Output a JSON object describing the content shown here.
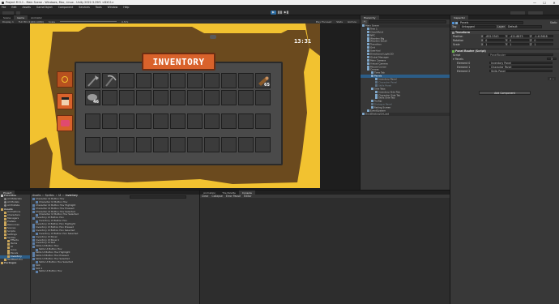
{
  "window": {
    "title": "Project M 0.1 - Main Scene - Windows, Mac, Linux - Unity 2022.3.25f1 <DX11>",
    "minimize": "—",
    "maximize": "☐",
    "close": "✕"
  },
  "menu": [
    "File",
    "Edit",
    "Assets",
    "GameObject",
    "Component",
    "Services",
    "Tools",
    "Window",
    "Help"
  ],
  "tabs": {
    "scene": "Scene",
    "game": "Game",
    "animator": "Animator"
  },
  "game_toolbar": {
    "display": "Game",
    "display_num": "Display 1",
    "aspect": "Full HD (1920x1080)",
    "scale": "Scale",
    "scale_value": "0.57x",
    "play_mode": "Play Focused",
    "stats": "Stats",
    "gizmos": "Gizmos"
  },
  "game": {
    "clock": "13:31",
    "inventory_title": "INVENTORY",
    "slot_counts": {
      "stone": "46",
      "log": "65"
    },
    "colors": {
      "sand": "#f2c230",
      "dirt": "#6b4a1e",
      "accent": "#d9622b"
    }
  },
  "hierarchy": {
    "tab": "Hierarchy",
    "search_placeholder": "All",
    "items": [
      {
        "label": "Main Scene",
        "indent": 0,
        "type": "scene"
      },
      {
        "label": "Tree 1",
        "indent": 1
      },
      {
        "label": "CheckPoint",
        "indent": 1
      },
      {
        "label": "NPC",
        "indent": 1
      },
      {
        "label": "Wooden Big",
        "indent": 1
      },
      {
        "label": "Wooden Small",
        "indent": 1
      },
      {
        "label": "Transition",
        "indent": 1
      },
      {
        "label": "Grid",
        "indent": 1
      },
      {
        "label": "UserHud",
        "indent": 1
      },
      {
        "label": "Directional Light 2D",
        "indent": 1
      },
      {
        "label": "Global Manager",
        "indent": 1
      },
      {
        "label": "Main Camera",
        "indent": 1
      },
      {
        "label": "Virtual Camera",
        "indent": 1
      },
      {
        "label": "Mouse Cursor",
        "indent": 1
      },
      {
        "label": "Canvas",
        "indent": 1
      },
      {
        "label": "Time Tab",
        "indent": 2
      },
      {
        "label": "Panels",
        "indent": 2,
        "selected": true
      },
      {
        "label": "Inventory Panel",
        "indent": 3
      },
      {
        "label": "Character Panel",
        "indent": 3,
        "dim": true
      },
      {
        "label": "Skills Panel",
        "indent": 3,
        "dim": true
      },
      {
        "label": "Side Tabs",
        "indent": 2
      },
      {
        "label": "Inventory Side Tab",
        "indent": 3
      },
      {
        "label": "Character Side Tab",
        "indent": 3
      },
      {
        "label": "Skills Side Tab",
        "indent": 3
      },
      {
        "label": "Tooltip",
        "indent": 2
      },
      {
        "label": "Dialogue Panel",
        "indent": 2,
        "dim": true
      },
      {
        "label": "Fading Screen",
        "indent": 2
      },
      {
        "label": "EventSystem",
        "indent": 1
      },
      {
        "label": "DontDestroyOnLoad",
        "indent": 0,
        "type": "scene"
      }
    ]
  },
  "inspector": {
    "tab": "Inspector",
    "object_name": "Panels",
    "static": "Static",
    "tag_label": "Tag",
    "tag": "Untagged",
    "layer_label": "Layer",
    "layer": "Default",
    "transform": {
      "header": "Transform",
      "position_label": "Position",
      "rotation_label": "Rotation",
      "scale_label": "Scale",
      "pos": [
        "-832.3343",
        "-421.8873",
        "-1.415618"
      ],
      "rot": [
        "0",
        "0",
        "0"
      ],
      "scl": [
        "1",
        "1",
        "1"
      ]
    },
    "script": {
      "header": "Panel Router (Script)",
      "script_label": "Script",
      "script_value": "PanelRouter",
      "panels_label": "Panels",
      "panels_count": "3",
      "elements": [
        {
          "label": "Element 0",
          "value": "Inventory Panel"
        },
        {
          "label": "Element 1",
          "value": "Character Panel"
        },
        {
          "label": "Element 2",
          "value": "Skills Panel"
        }
      ]
    },
    "add_component": "Add Component"
  },
  "project": {
    "tab": "Project",
    "tree": [
      {
        "label": "Favorites",
        "indent": 0
      },
      {
        "label": "All Materials",
        "indent": 1
      },
      {
        "label": "All Models",
        "indent": 1
      },
      {
        "label": "All Prefabs",
        "indent": 1
      },
      {
        "label": "Assets",
        "indent": 0
      },
      {
        "label": "Animations",
        "indent": 1
      },
      {
        "label": "Characters",
        "indent": 1
      },
      {
        "label": "Managers",
        "indent": 1
      },
      {
        "label": "Prefabs",
        "indent": 1
      },
      {
        "label": "Resources",
        "indent": 1
      },
      {
        "label": "Scenes",
        "indent": 1
      },
      {
        "label": "Scripts",
        "indent": 1
      },
      {
        "label": "Settings",
        "indent": 1
      },
      {
        "label": "Sprites",
        "indent": 1
      },
      {
        "label": "Effects",
        "indent": 2
      },
      {
        "label": "Items",
        "indent": 2
      },
      {
        "label": "UI",
        "indent": 2
      },
      {
        "label": "Icons",
        "indent": 2
      },
      {
        "label": "Panels",
        "indent": 2
      },
      {
        "label": "Inventory",
        "indent": 2,
        "selected": true
      },
      {
        "label": "TextMesh Pro",
        "indent": 1
      },
      {
        "label": "Packages",
        "indent": 0
      }
    ],
    "breadcrumb": [
      "Assets",
      "Sprites",
      "UI",
      "Inventory"
    ],
    "files": [
      "Character UI Button Hov",
      "Character UI Button Hov",
      "Character UI Button Hov Highlight",
      "Character UI Button Hov Pressed",
      "Character UI Button Hov Selected",
      "Character UI Button Hov Selected",
      "Inventory UI Button Hov",
      "Inventory UI Button Hov",
      "Inventory UI Button Hov Highlight",
      "Inventory UI Button Hov Pressed",
      "Inventory UI Button Hov Selected",
      "Inventory UI Button Hov Selected",
      "Inventory UI Panel",
      "Inventory UI Panel 1",
      "Inventory UI Slot",
      "Skills UI Button Hov",
      "Skills UI Button Hov",
      "Skills UI Button Hov Highlight",
      "Skills UI Button Hov Pressed",
      "Skills UI Button Hov Selected",
      "Skills UI Button Hov Selected",
      "Slot",
      "Slot 1",
      "Skills UI Button Hov"
    ]
  },
  "console": {
    "tabs": [
      "Animation",
      "Tile Palette",
      "Console"
    ],
    "clear": "Clear",
    "collapse": "Collapse",
    "error_pause": "Error Pause",
    "editor": "Editor"
  }
}
